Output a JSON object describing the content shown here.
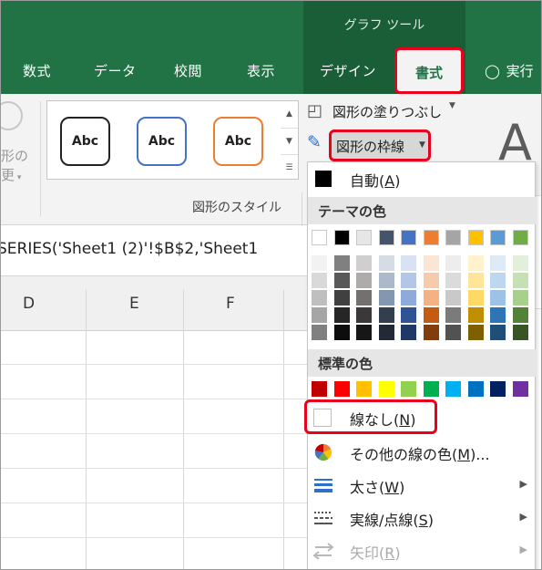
{
  "title_band": {
    "context_group_label": "グラフ ツール"
  },
  "tabs": [
    "数式",
    "データ",
    "校閲",
    "表示",
    "デザイン"
  ],
  "active_tab": "書式",
  "help_label": "実行",
  "ribbon": {
    "change_shape_label_1": "形の",
    "change_shape_label_2": "更",
    "shape_styles_label": "図形のスタイル",
    "style_samples": [
      "Abc",
      "Abc",
      "Abc"
    ],
    "shape_fill_label": "図形の塗りつぶし",
    "shape_outline_label": "図形の枠線",
    "wordart_letter": "A"
  },
  "formula": {
    "text": "SERIES('Sheet1 (2)'!$B$2,'Sheet1"
  },
  "sheet": {
    "columns": [
      "D",
      "E",
      "F"
    ]
  },
  "menu": {
    "automatic": {
      "text": "自動(",
      "key": "A",
      "close": ")"
    },
    "theme_colors_header": "テーマの色",
    "standard_colors_header": "標準の色",
    "no_line": {
      "text": "線なし(",
      "key": "N",
      "close": ")"
    },
    "more_colors": {
      "text": "その他の線の色(",
      "key": "M",
      "close": ")..."
    },
    "weight": {
      "text": "太さ(",
      "key": "W",
      "close": ")"
    },
    "dashes": {
      "text": "実線/点線(",
      "key": "S",
      "close": ")"
    },
    "arrows": {
      "text": "矢印(",
      "key": "R",
      "close": ")"
    }
  },
  "colors": {
    "accent": "#217346",
    "highlight": "#e8001c",
    "theme_top": [
      "#ffffff",
      "#000000",
      "#e7e6e6",
      "#44546a",
      "#4472c4",
      "#ed7d31",
      "#a5a5a5",
      "#ffc000",
      "#5b9bd5",
      "#70ad47"
    ],
    "theme_shades": [
      [
        "#f2f2f2",
        "#d9d9d9",
        "#bfbfbf",
        "#a6a6a6",
        "#808080"
      ],
      [
        "#808080",
        "#595959",
        "#404040",
        "#262626",
        "#0d0d0d"
      ],
      [
        "#d0cece",
        "#aeabab",
        "#757070",
        "#3a3838",
        "#171616"
      ],
      [
        "#d6dce4",
        "#acb9ca",
        "#8497b0",
        "#333f4f",
        "#222a35"
      ],
      [
        "#d9e2f3",
        "#b4c6e7",
        "#8eaadb",
        "#2f5496",
        "#1f3864"
      ],
      [
        "#fbe5d5",
        "#f7caac",
        "#f4b183",
        "#c55a11",
        "#833c0b"
      ],
      [
        "#ededed",
        "#dbdbdb",
        "#c9c9c9",
        "#7b7b7b",
        "#525252"
      ],
      [
        "#fff2cc",
        "#fee599",
        "#ffd966",
        "#bf8f00",
        "#7f6000"
      ],
      [
        "#deeaf6",
        "#bdd7ee",
        "#9cc3e5",
        "#2e75b5",
        "#1f4e79"
      ],
      [
        "#e2efd9",
        "#c5e0b3",
        "#a8d08d",
        "#538135",
        "#375623"
      ]
    ],
    "standard": [
      "#c00000",
      "#ff0000",
      "#ffc000",
      "#ffff00",
      "#92d050",
      "#00b050",
      "#00b0f0",
      "#0070c0",
      "#002060",
      "#7030a0"
    ]
  }
}
